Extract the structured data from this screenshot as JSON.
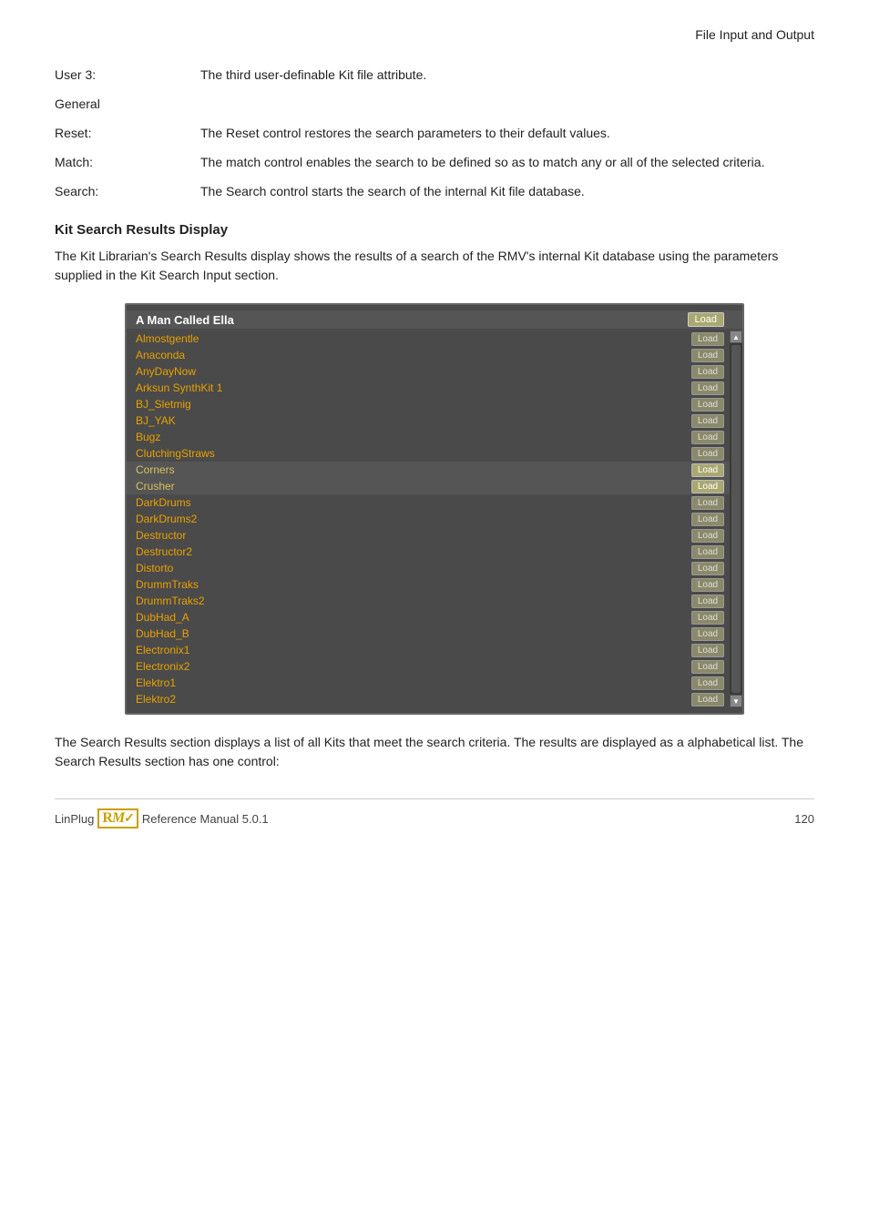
{
  "header": {
    "title": "File Input and Output"
  },
  "doc_items": [
    {
      "label": "User 3:",
      "desc": "The third user-definable Kit file attribute."
    },
    {
      "label": "General",
      "desc": ""
    },
    {
      "label": "Reset:",
      "desc": "The Reset control restores the search parameters to their default values."
    },
    {
      "label": "Match:",
      "desc": "The match control enables the search to be defined so as to match any or all of the selected criteria."
    },
    {
      "label": "Search:",
      "desc": "The Search control starts the search of the internal Kit file database."
    }
  ],
  "section_heading": "Kit Search Results Display",
  "intro_text": "The Kit Librarian's Search Results display shows the results of a search of the RMV's internal Kit database using the parameters supplied in the Kit Search Input section.",
  "kit_list": {
    "header_name": "A Man Called Ella",
    "header_load": "Load",
    "items": [
      {
        "name": "Almostgentle",
        "load": "Load",
        "style": "orange",
        "active": false
      },
      {
        "name": "Anaconda",
        "load": "Load",
        "style": "orange",
        "active": false
      },
      {
        "name": "AnyDayNow",
        "load": "Load",
        "style": "orange",
        "active": false
      },
      {
        "name": "Arksun SynthKit 1",
        "load": "Load",
        "style": "orange",
        "active": false
      },
      {
        "name": "BJ_Sletmig",
        "load": "Load",
        "style": "orange",
        "active": false
      },
      {
        "name": "BJ_YAK",
        "load": "Load",
        "style": "orange",
        "active": false
      },
      {
        "name": "Bugz",
        "load": "Load",
        "style": "orange",
        "active": false
      },
      {
        "name": "ClutchingStraws",
        "load": "Load",
        "style": "orange",
        "active": false
      },
      {
        "name": "Corners",
        "load": "Load",
        "style": "yellow",
        "active": true
      },
      {
        "name": "Crusher",
        "load": "Load",
        "style": "yellow",
        "active": true
      },
      {
        "name": "DarkDrums",
        "load": "Load",
        "style": "orange",
        "active": false
      },
      {
        "name": "DarkDrums2",
        "load": "Load",
        "style": "orange",
        "active": false
      },
      {
        "name": "Destructor",
        "load": "Load",
        "style": "orange",
        "active": false
      },
      {
        "name": "Destructor2",
        "load": "Load",
        "style": "orange",
        "active": false
      },
      {
        "name": "Distorto",
        "load": "Load",
        "style": "orange",
        "active": false
      },
      {
        "name": "DrummTraks",
        "load": "Load",
        "style": "orange",
        "active": false
      },
      {
        "name": "DrummTraks2",
        "load": "Load",
        "style": "orange",
        "active": false
      },
      {
        "name": "DubHad_A",
        "load": "Load",
        "style": "orange",
        "active": false
      },
      {
        "name": "DubHad_B",
        "load": "Load",
        "style": "orange",
        "active": false
      },
      {
        "name": "Electronix1",
        "load": "Load",
        "style": "orange",
        "active": false
      },
      {
        "name": "Electronix2",
        "load": "Load",
        "style": "orange",
        "active": false
      },
      {
        "name": "Elektro1",
        "load": "Load",
        "style": "orange",
        "active": false
      },
      {
        "name": "Elektro2",
        "load": "Load",
        "style": "orange",
        "active": false
      }
    ]
  },
  "outro_text": "The Search Results section displays a list of all Kits that meet the search criteria. The results are displayed as a alphabetical list. The Search Results section has one control:",
  "footer": {
    "brand": "LinPlug",
    "logo_text": "RMV",
    "manual": "Reference Manual 5.0.1",
    "page": "120"
  }
}
